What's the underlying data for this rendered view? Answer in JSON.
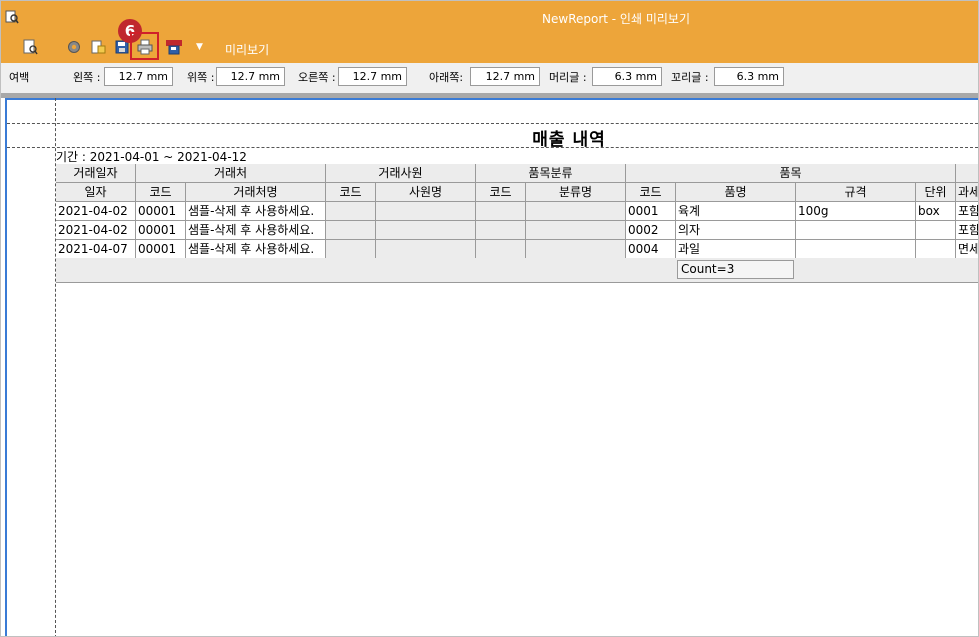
{
  "window": {
    "title": "NewReport - 인쇄 미리보기"
  },
  "ribbon": {
    "label": "미리보기",
    "step_badge": "6"
  },
  "margins": {
    "section_label": "여백",
    "left_label": "왼쪽 :",
    "left_value": "12.7 mm",
    "top_label": "위쪽 :",
    "top_value": "12.7 mm",
    "right_label": "오른쪽 :",
    "right_value": "12.7 mm",
    "bottom_label": "아래쪽:",
    "bottom_value": "12.7 mm",
    "header_label": "머리글 :",
    "header_value": "6.3 mm",
    "footer_label": "꼬리글 :",
    "footer_value": "6.3 mm"
  },
  "report": {
    "title": "매출 내역",
    "period": "기간 : 2021-04-01 ~ 2021-04-12",
    "group_headers": {
      "date": "거래일자",
      "customer": "거래처",
      "employee": "거래사원",
      "category": "품목분류",
      "item": "품목"
    },
    "columns": {
      "date": "일자",
      "cust_code": "코드",
      "cust_name": "거래처명",
      "emp_code": "코드",
      "emp_name": "사원명",
      "cat_code": "코드",
      "cat_name": "분류명",
      "item_code": "코드",
      "item_name": "품명",
      "spec": "규격",
      "unit": "단위",
      "tax": "과세"
    },
    "rows": [
      {
        "date": "2021-04-02",
        "cust_code": "00001",
        "cust_name": "샘플-삭제 후 사용하세요.",
        "emp_code": "",
        "emp_name": "",
        "cat_code": "",
        "cat_name": "",
        "item_code": "0001",
        "item_name": "육계",
        "spec": "100g",
        "unit": "box",
        "tax": "포함"
      },
      {
        "date": "2021-04-02",
        "cust_code": "00001",
        "cust_name": "샘플-삭제 후 사용하세요.",
        "emp_code": "",
        "emp_name": "",
        "cat_code": "",
        "cat_name": "",
        "item_code": "0002",
        "item_name": "의자",
        "spec": "",
        "unit": "",
        "tax": "포함"
      },
      {
        "date": "2021-04-07",
        "cust_code": "00001",
        "cust_name": "샘플-삭제 후 사용하세요.",
        "emp_code": "",
        "emp_name": "",
        "cat_code": "",
        "cat_name": "",
        "item_code": "0004",
        "item_name": "과일",
        "spec": "",
        "unit": "",
        "tax": "면세"
      }
    ],
    "count": "Count=3"
  },
  "colors": {
    "accent": "#eda53a",
    "badge": "#c0282d",
    "page_border": "#3a7bd5"
  }
}
